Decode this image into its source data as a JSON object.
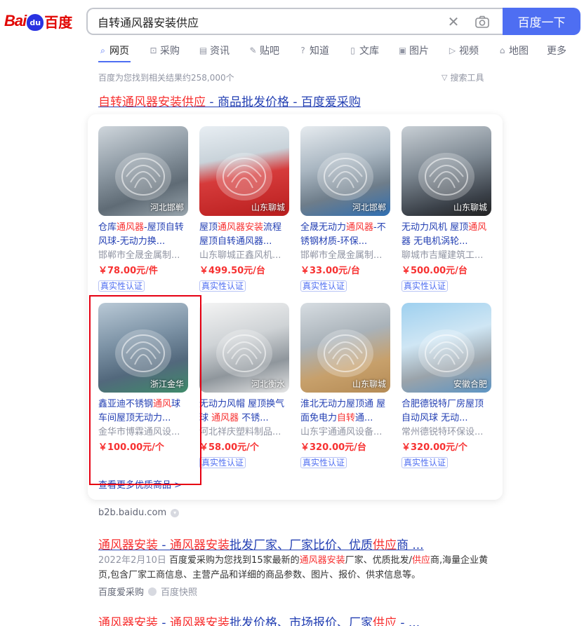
{
  "logo": {
    "bai": "Bai",
    "du_icon": "du",
    "du": "百度"
  },
  "search": {
    "query": "自转通风器安装供应",
    "button": "百度一下"
  },
  "tabs": [
    {
      "label": "网页",
      "icon": "search-icon"
    },
    {
      "label": "采购",
      "icon": "purchase-icon"
    },
    {
      "label": "资讯",
      "icon": "news-icon"
    },
    {
      "label": "贴吧",
      "icon": "tieba-icon"
    },
    {
      "label": "知道",
      "icon": "question-icon"
    },
    {
      "label": "文库",
      "icon": "doc-icon"
    },
    {
      "label": "图片",
      "icon": "image-icon"
    },
    {
      "label": "视频",
      "icon": "video-icon"
    },
    {
      "label": "地图",
      "icon": "map-icon"
    },
    {
      "label": "更多",
      "icon": ""
    }
  ],
  "result_count": "百度为您找到相关结果约258,000个",
  "search_tools": "搜索工具",
  "result1": {
    "title_hl": "自转通风器安装供应",
    "title_rest": " - 商品批发价格 - 百度爱采购",
    "products": [
      {
        "name_pre": "仓库",
        "name_hl": "通风器",
        "name_post": "-屋顶自转风球-无动力换...",
        "shop": "邯郸市全晟金属制...",
        "price": "￥78.00元/件",
        "badge": "真实性认证",
        "loc": "河北邯郸"
      },
      {
        "name_pre": "屋顶",
        "name_hl": "通风器安装",
        "name_post": "流程 屋顶自转通风器...",
        "shop": "山东聊城正鑫风机...",
        "price": "￥499.50元/台",
        "badge": "真实性认证",
        "loc": "山东聊城"
      },
      {
        "name_pre": "全晟无动力",
        "name_hl": "通风器",
        "name_post": "-不锈钢材质-环保...",
        "shop": "邯郸市全晟金属制...",
        "price": "￥33.00元/台",
        "badge": "真实性认证",
        "loc": "河北邯郸"
      },
      {
        "name_pre": "无动力风机 屋顶",
        "name_hl": "通风",
        "name_post": "器 无电机涡轮...",
        "shop": "聊城市吉耀建筑工...",
        "price": "￥500.00元/台",
        "badge": "真实性认证",
        "loc": "山东聊城"
      },
      {
        "name_pre": "鑫亚迪不锈钢",
        "name_hl": "通风",
        "name_post": "球车间屋顶无动力...",
        "shop": "金华市博霖通风设...",
        "price": "￥100.00元/个",
        "badge": "",
        "loc": "浙江金华"
      },
      {
        "name_pre": "无动力风帽 屋顶换气球 ",
        "name_hl": "通风器",
        "name_post": " 不锈...",
        "shop": "河北祥庆塑料制品...",
        "price": "￥58.00元/个",
        "badge": "真实性认证",
        "loc": "河北衡水"
      },
      {
        "name_pre": "淮北无动力屋顶通 屋面免电力",
        "name_hl": "自转",
        "name_post": "通...",
        "shop": "山东宇通通风设备...",
        "price": "￥320.00元/台",
        "badge": "真实性认证",
        "loc": "山东聊城"
      },
      {
        "name_pre": "合肥德锐特厂房屋顶自动风球 无动...",
        "name_hl": "",
        "name_post": "",
        "shop": "常州德锐特环保设...",
        "price": "￥320.00元/个",
        "badge": "真实性认证",
        "loc": "安徽合肥"
      }
    ],
    "see_more": "查看更多优质商品 >",
    "source": "b2b.baidu.com"
  },
  "result2": {
    "title_hl1": "通风器安装",
    "title_mid": " - ",
    "title_hl2": "通风器安装",
    "title_rest": "批发厂家、厂家比价、优质",
    "title_hl3": "供应",
    "title_end": "商 ...",
    "date": "2022年2月10日",
    "snippet_a": "百度爱采购为您找到15家最新的",
    "snippet_hl1": "通风器安装",
    "snippet_b": "厂家、优质批发/",
    "snippet_hl2": "供应",
    "snippet_c": "商,海量企业黄页,包含厂家工商信息、主营产品和详细的商品参数、图片、报价、供求信息等。",
    "source": "百度爱采购",
    "snapshot": "百度快照"
  },
  "result3": {
    "title_hl1": "通风器安装",
    "title_mid": " - ",
    "title_hl2": "通风器安装",
    "title_rest": "批发价格、市场报价、厂家",
    "title_hl3": "供应",
    "title_end": " - ..."
  }
}
